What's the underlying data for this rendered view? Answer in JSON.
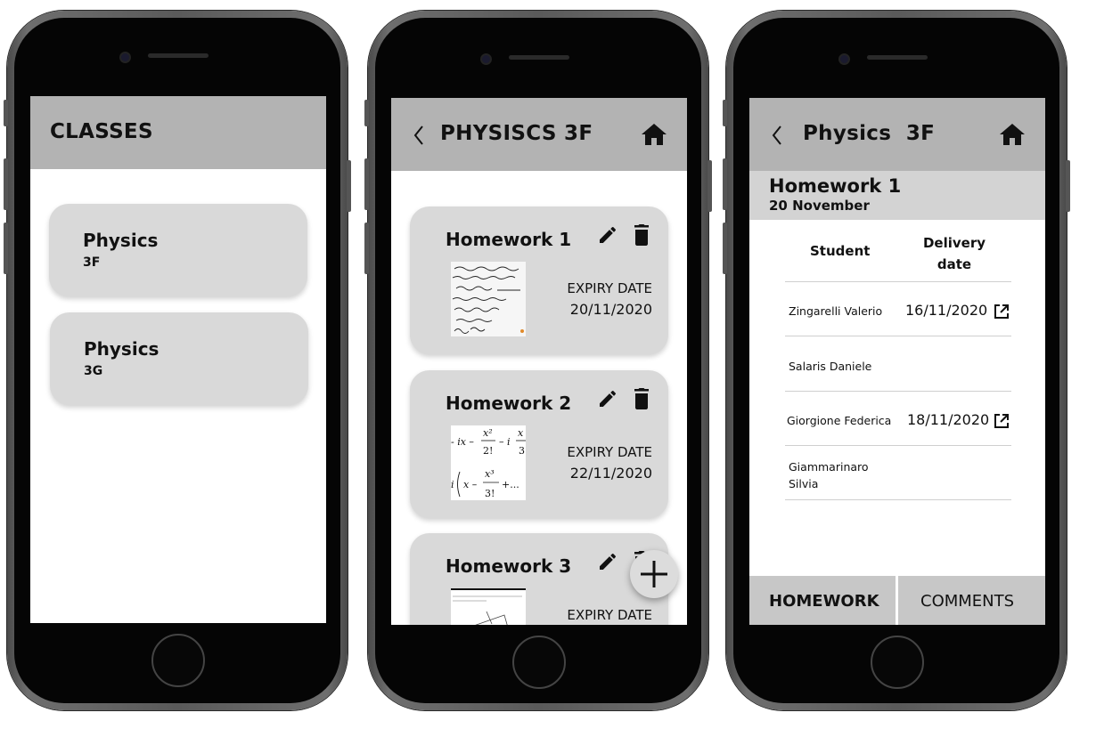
{
  "screen1": {
    "header_title": "CLASSES",
    "classes": [
      {
        "name": "Physics",
        "section": "3F"
      },
      {
        "name": "Physics",
        "section": "3G"
      }
    ]
  },
  "screen2": {
    "header_title": "PHYSISCS 3F",
    "homeworks": [
      {
        "title": "Homework 1",
        "expiry_label": "EXPIRY DATE",
        "expiry_date": "20/11/2020"
      },
      {
        "title": "Homework 2",
        "expiry_label": "EXPIRY DATE",
        "expiry_date": "22/11/2020"
      },
      {
        "title": "Homework 3",
        "expiry_label": "EXPIRY DATE",
        "expiry_date": ""
      }
    ],
    "fab_icon": "plus-icon"
  },
  "screen3": {
    "header_title": "Physics  3F",
    "homework_title": "Homework 1",
    "homework_date": "20 November",
    "table": {
      "col_student": "Student",
      "col_delivery_1": "Delivery",
      "col_delivery_2": "date",
      "rows": [
        {
          "student": "Zingarelli Valerio",
          "student2": "",
          "date": "16/11/2020",
          "has_link": true
        },
        {
          "student": "Salaris Daniele",
          "student2": "",
          "date": "",
          "has_link": false
        },
        {
          "student": "Giorgione Federica",
          "student2": "",
          "date": "18/11/2020",
          "has_link": true
        },
        {
          "student": "Giammarinaro",
          "student2": "Silvia",
          "date": "",
          "has_link": false
        }
      ]
    },
    "tabs": {
      "homework": "HOMEWORK",
      "comments": "COMMENTS"
    }
  },
  "colors": {
    "header_gray": "#b3b3b3",
    "card_gray": "#d9d9d9",
    "tab_gray": "#c7c7c7"
  }
}
